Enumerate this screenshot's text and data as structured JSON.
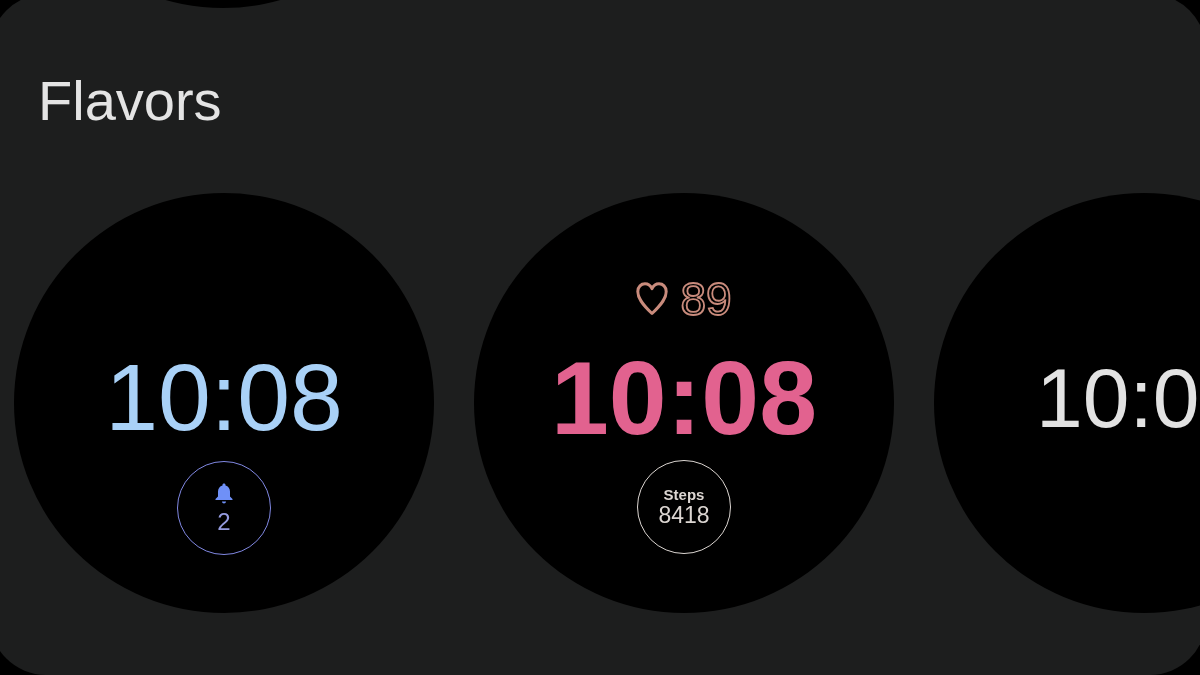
{
  "section": {
    "title": "Flavors"
  },
  "watch_faces": [
    {
      "kind": "classic",
      "time": "10:08",
      "color": "#a9d1f7",
      "complication": {
        "kind": "notification",
        "value": "2",
        "color": "#8088e2"
      }
    },
    {
      "kind": "bold",
      "time": "10:08",
      "color": "#e2628f",
      "top_complication": {
        "kind": "heart_rate",
        "value": "89",
        "color": "#c98b7c"
      },
      "complication": {
        "kind": "steps",
        "label": "Steps",
        "value": "8418",
        "color": "#dcd6d2"
      }
    },
    {
      "kind": "thin",
      "time": "10:0",
      "color": "#e2e2e2"
    }
  ]
}
